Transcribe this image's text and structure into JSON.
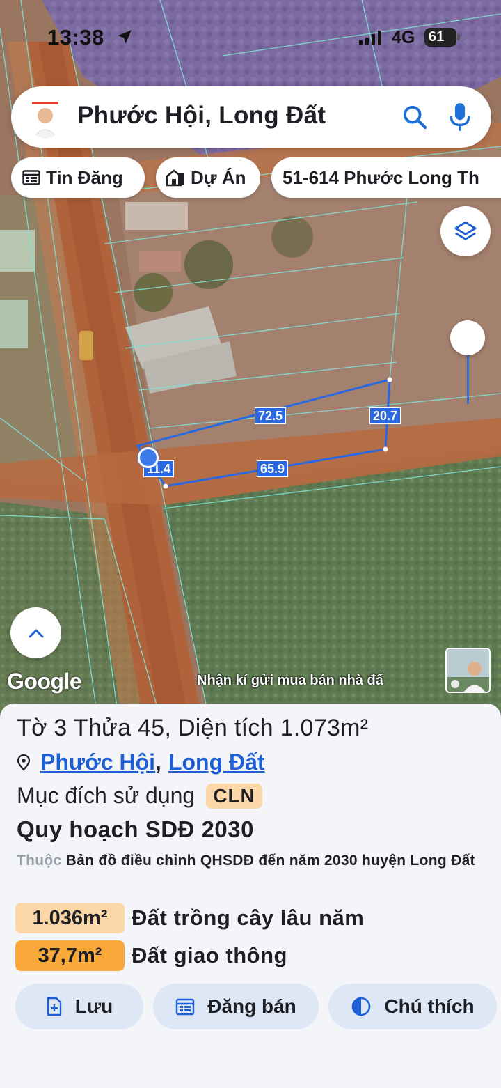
{
  "status_bar": {
    "time": "13:38",
    "network": "4G",
    "battery": "61"
  },
  "search": {
    "title": "Phước Hội, Long Đất"
  },
  "chips": [
    {
      "label": "Tin Đăng",
      "icon": "listing-icon"
    },
    {
      "label": "Dự Án",
      "icon": "building-icon"
    },
    {
      "label": "51-614 Phước Long Th",
      "icon": ""
    }
  ],
  "map": {
    "google_label": "Google",
    "ad_text": "Nhận kí gửi mua bán nhà đấ",
    "dimensions": {
      "top": "72.5",
      "right": "20.7",
      "bottom": "65.9",
      "left": "11.4"
    }
  },
  "parcel": {
    "title": "Tờ 3 Thửa 45, Diện tích 1.073m²",
    "ward": "Phước Hội",
    "separator": ",",
    "district": "Long Đất",
    "purpose_label": "Mục đích sử dụng",
    "purpose_code": "CLN",
    "plan_title": "Quy hoạch SDĐ 2030",
    "plan_desc_prefix": "Thuộc",
    "plan_desc": "Bản đồ điều chỉnh QHSDĐ đến năm 2030 huyện Long Đất",
    "areas": [
      {
        "value": "1.036m²",
        "label": "Đất trồng cây lâu năm",
        "color": "#fcd8a8"
      },
      {
        "value": "37,7m²",
        "label": "Đất giao thông",
        "color": "#f9a83a"
      }
    ]
  },
  "actions": [
    {
      "label": "Lưu",
      "icon": "save-add-icon"
    },
    {
      "label": "Đăng bán",
      "icon": "calendar-post-icon"
    },
    {
      "label": "Chú thích",
      "icon": "legend-contrast-icon"
    }
  ],
  "colors": {
    "accent": "#1f5fd6",
    "action_bg": "#dde7f6",
    "parcel_line": "#2968e0"
  }
}
